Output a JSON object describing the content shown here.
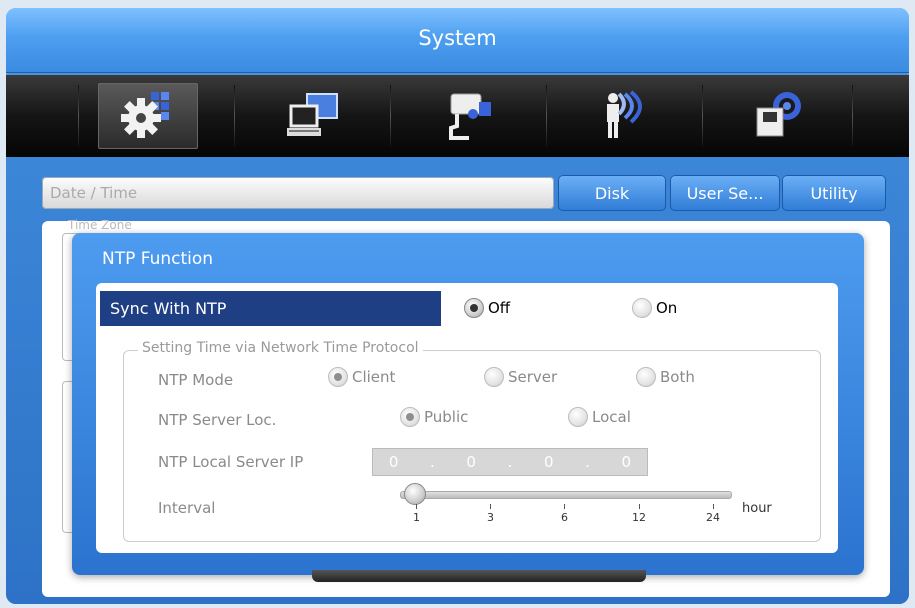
{
  "window": {
    "title": "System"
  },
  "toolbar_icons": [
    {
      "name": "system-settings-icon",
      "selected": true
    },
    {
      "name": "network-icon",
      "selected": false
    },
    {
      "name": "camera-icon",
      "selected": false
    },
    {
      "name": "event-icon",
      "selected": false
    },
    {
      "name": "storage-icon",
      "selected": false
    }
  ],
  "tabs": {
    "current": "Date / Time",
    "items": [
      "Disk",
      "User Se...",
      "Utility"
    ]
  },
  "background": {
    "ghost_label": "Time Zone"
  },
  "dialog": {
    "title": "NTP Function",
    "sync_label": "Sync With NTP",
    "sync_options": {
      "off": "Off",
      "on": "On",
      "selected": "Off"
    },
    "group_label": "Setting Time via Network Time Protocol",
    "ntp_mode": {
      "label": "NTP Mode",
      "options": [
        "Client",
        "Server",
        "Both"
      ],
      "selected": "Client"
    },
    "server_loc": {
      "label": "NTP Server Loc.",
      "options": [
        "Public",
        "Local"
      ],
      "selected": "Public"
    },
    "local_ip": {
      "label": "NTP Local Server IP",
      "octets": [
        "0",
        "0",
        "0",
        "0"
      ]
    },
    "interval": {
      "label": "Interval",
      "ticks": [
        "1",
        "3",
        "6",
        "12",
        "24"
      ],
      "unit": "hour",
      "value": "1"
    }
  },
  "colors": {
    "accent": "#2f78cc",
    "title_bar": "#4d9ff0",
    "selected_row": "#1f3f84"
  }
}
